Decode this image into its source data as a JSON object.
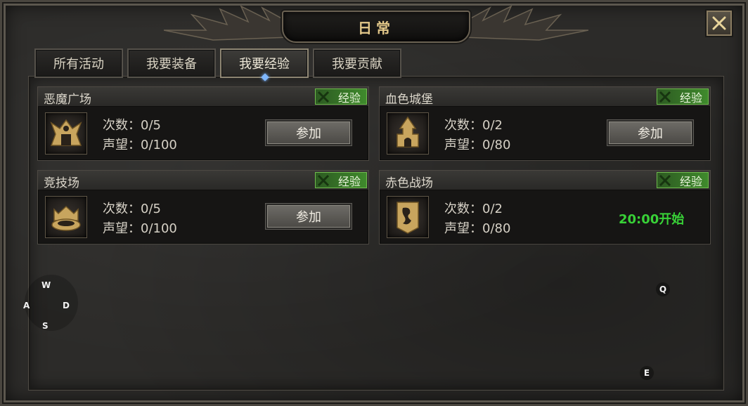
{
  "window": {
    "title": "日常",
    "close_icon": "close-icon"
  },
  "tabs": [
    {
      "label": "所有活动",
      "active": false
    },
    {
      "label": "我要装备",
      "active": false
    },
    {
      "label": "我要经验",
      "active": true
    },
    {
      "label": "我要贡献",
      "active": false
    }
  ],
  "cards": [
    {
      "name": "恶魔广场",
      "badge": "经验",
      "icon": "demon-square-icon",
      "count_label": "次数：0/5",
      "rep_label": "声望：0/100",
      "action": "参加",
      "start_time": ""
    },
    {
      "name": "血色城堡",
      "badge": "经验",
      "icon": "blood-castle-icon",
      "count_label": "次数：0/2",
      "rep_label": "声望：0/80",
      "action": "参加",
      "start_time": ""
    },
    {
      "name": "竞技场",
      "badge": "经验",
      "icon": "arena-icon",
      "count_label": "次数：0/5",
      "rep_label": "声望：0/100",
      "action": "参加",
      "start_time": ""
    },
    {
      "name": "赤色战场",
      "badge": "经验",
      "icon": "red-battlefield-icon",
      "count_label": "次数：0/2",
      "rep_label": "声望：0/80",
      "action": "",
      "start_time": "20:00开始"
    }
  ],
  "controls": {
    "keys": {
      "w": "W",
      "a": "A",
      "s": "S",
      "d": "D",
      "q": "Q",
      "e": "E"
    }
  },
  "colors": {
    "badge_green": "#3f8a2c",
    "start_green": "#38d137",
    "title_gold": "#e3c88a"
  }
}
